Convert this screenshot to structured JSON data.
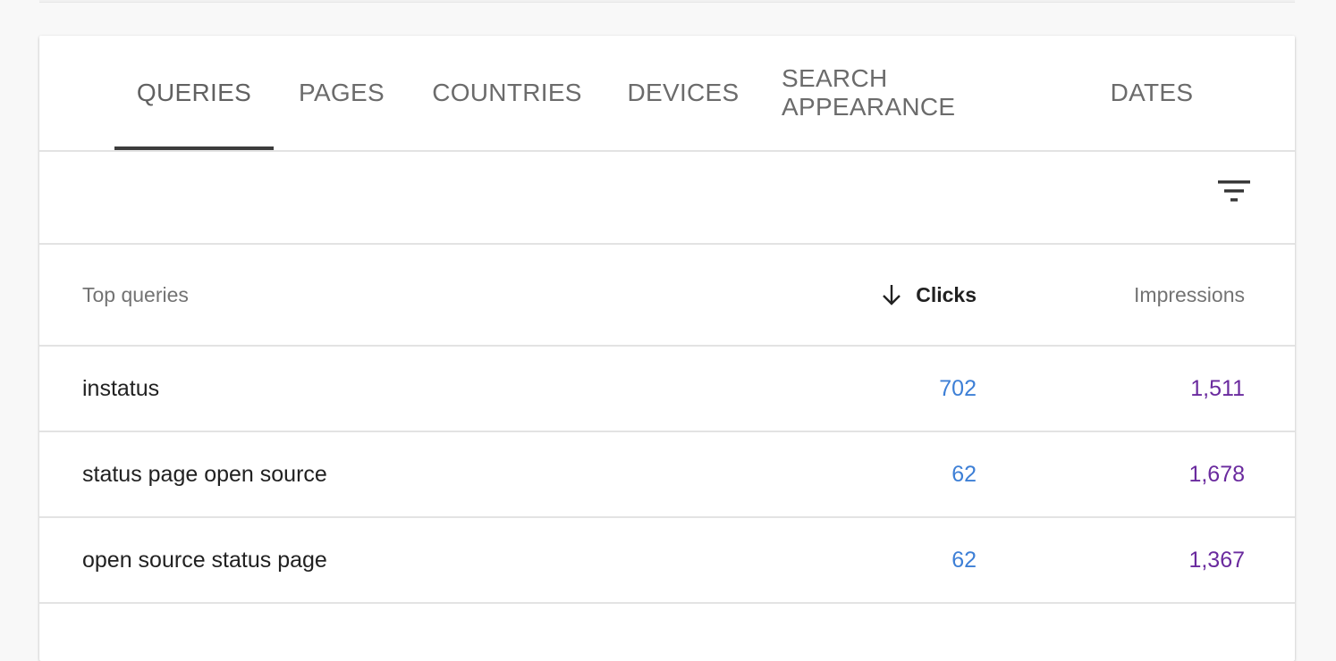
{
  "tabs": [
    {
      "label": "QUERIES",
      "active": true
    },
    {
      "label": "PAGES",
      "active": false
    },
    {
      "label": "COUNTRIES",
      "active": false
    },
    {
      "label": "DEVICES",
      "active": false
    },
    {
      "label": "SEARCH APPEARANCE",
      "active": false
    },
    {
      "label": "DATES",
      "active": false
    }
  ],
  "toolbar": {
    "filter_icon": "filter-icon"
  },
  "table": {
    "headers": {
      "query": "Top queries",
      "clicks": "Clicks",
      "impressions": "Impressions",
      "sort_icon": "arrow-down-icon"
    },
    "rows": [
      {
        "query": "instatus",
        "clicks": "702",
        "impressions": "1,511"
      },
      {
        "query": "status page open source",
        "clicks": "62",
        "impressions": "1,678"
      },
      {
        "query": "open source status page",
        "clicks": "62",
        "impressions": "1,367"
      }
    ]
  },
  "colors": {
    "clicks": "#3d7fd6",
    "impressions": "#6a2a9e",
    "active_tab_indicator": "#3c3c3c"
  }
}
